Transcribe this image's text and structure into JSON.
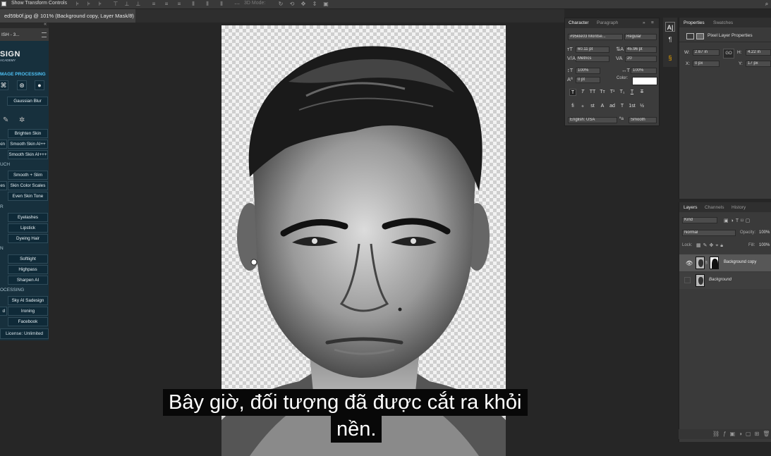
{
  "options_bar": {
    "show_transform_label": "Show Transform Controls",
    "mode_3d_label": "3D Mode:"
  },
  "document_tab": {
    "title": "ed59b0f.jpg @ 101% (Background copy, Layer Mask/8)",
    "close": "×"
  },
  "plugin_panel": {
    "title": "ISH - 3...",
    "brand": "SIGN",
    "brand_sub": "ACADEMY",
    "sections": {
      "image_processing": "MAGE PROCESSING",
      "touch": "UCH",
      "r": "R",
      "n": "N",
      "processing": "OCESSING"
    },
    "buttons": {
      "gaussian_blur": "Gaussian Blur",
      "brighten_skin": "Brighten Skin",
      "kin": "kin",
      "smooth_skin_ai_pp": "Smooth Skin AI++",
      "smooth_skin_ai_ppp": "Smooth Skin AI+++",
      "smooth_slim": "Smooth + Slim",
      "es": "es",
      "skin_color_scales": "Skin Color Scales",
      "even_skin_tone": "Even Skin Tone",
      "eyelashes": "Eyelashes",
      "lipstick": "Lipstick",
      "dyeing_hair": "Dyeing Hair",
      "softlight": "Softlight",
      "highpass": "Highpass",
      "sharpen_ai": "Sharpen AI",
      "sky_ai_sadesign": "Sky AI Sadesign",
      "d": "d",
      "ironing": "Ironing",
      "facebook": "Facebook"
    },
    "license": "License: Unlimited"
  },
  "character_panel": {
    "tabs": {
      "character": "Character",
      "paragraph": "Paragraph"
    },
    "font_family": "#95kle03 Montse...",
    "font_style": "Regular",
    "size": "60.11 pt",
    "leading": "45.96 pt",
    "kerning": "Metrics",
    "tracking": "20",
    "vscale": "100%",
    "hscale": "100%",
    "baseline": "0 pt",
    "color_label": "Color:",
    "language": "English: USA",
    "aa_label": "ªa",
    "antialias": "Smooth",
    "format_buttons": [
      "T",
      "T",
      "TT",
      "Tт",
      "T¹",
      "T₁",
      "T",
      "T"
    ],
    "opentype_buttons": [
      "ﬁ",
      "ℴ",
      "st",
      "A",
      "ad",
      "T",
      "1st",
      "½"
    ]
  },
  "properties_panel": {
    "tabs": {
      "properties": "Properties",
      "swatches": "Swatches"
    },
    "header": "Pixel Layer Properties",
    "w_label": "W:",
    "w": "2.67 in",
    "h_label": "H:",
    "h": "4.22 in",
    "x_label": "X:",
    "x": "0 px",
    "y_label": "Y:",
    "y": "17 px",
    "link_label": "GO"
  },
  "layers_panel": {
    "tabs": {
      "layers": "Layers",
      "channels": "Channels",
      "history": "History"
    },
    "filter": "Kind",
    "blend_mode": "Normal",
    "opacity_label": "Opacity:",
    "opacity": "100%",
    "lock_label": "Lock:",
    "fill_label": "Fill:",
    "fill": "100%",
    "layers": [
      {
        "name": "Background copy"
      },
      {
        "name": "Background"
      }
    ]
  },
  "subtitles": {
    "line1": "Bây giờ, đối tượng đã được cắt ra khỏi",
    "line2": "nền."
  },
  "colors": {
    "accent": "#4fc3f7",
    "plugin_bg": "#17303d",
    "panel_bg": "#3a3a3a",
    "app_bg": "#262626"
  }
}
